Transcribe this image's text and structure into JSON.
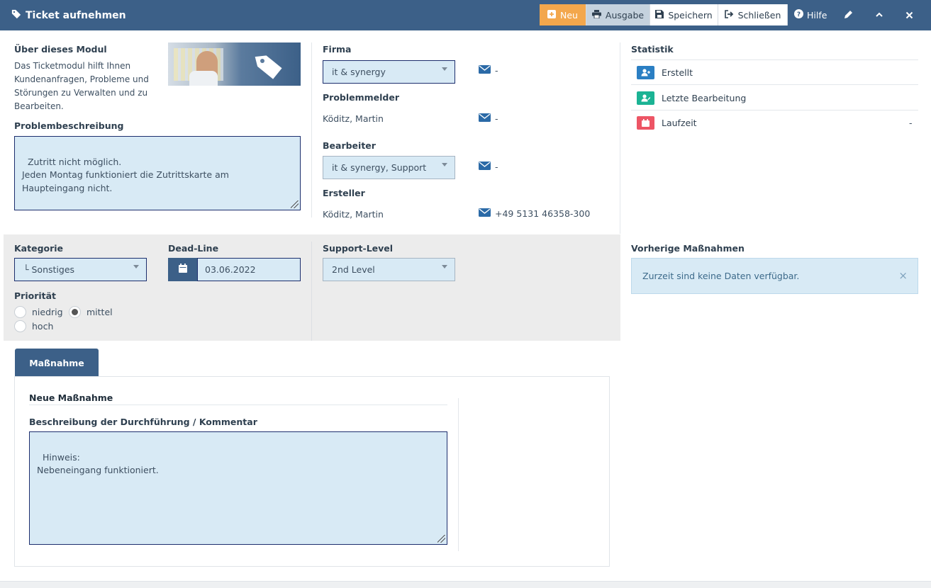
{
  "header": {
    "title": "Ticket aufnehmen",
    "buttons": {
      "neu": "Neu",
      "ausgabe": "Ausgabe",
      "speichern": "Speichern",
      "schliessen": "Schließen",
      "hilfe": "Hilfe"
    }
  },
  "about": {
    "title": "Über dieses Modul",
    "text": "Das Ticketmodul hilft Ihnen Kundenanfragen, Probleme und Störungen zu Verwalten und zu Bearbeiten."
  },
  "problem": {
    "label": "Problembeschreibung",
    "value": "Zutritt nicht möglich.\nJeden Montag funktioniert die Zutrittskarte am Haupteingang nicht."
  },
  "firma": {
    "label": "Firma",
    "value": "it & synergy",
    "mail": "-"
  },
  "problemmelder": {
    "label": "Problemmelder",
    "value": "Köditz, Martin",
    "mail": "-"
  },
  "bearbeiter": {
    "label": "Bearbeiter",
    "value": "it & synergy, Support",
    "mail": "-"
  },
  "ersteller": {
    "label": "Ersteller",
    "value": "Köditz, Martin",
    "phone": "+49 5131 46358-300"
  },
  "statistik": {
    "title": "Statistik",
    "items": [
      {
        "label": "Erstellt",
        "value": "",
        "color": "#2b7fc3"
      },
      {
        "label": "Letzte Bearbeitung",
        "value": "",
        "color": "#1bb394"
      },
      {
        "label": "Laufzeit",
        "value": "-",
        "color": "#ed5565"
      }
    ]
  },
  "kategorie": {
    "label": "Kategorie",
    "value": "└ Sonstiges"
  },
  "deadline": {
    "label": "Dead-Line",
    "value": "03.06.2022"
  },
  "supportlevel": {
    "label": "Support-Level",
    "value": "2nd Level"
  },
  "prioritaet": {
    "label": "Priorität",
    "options": [
      "niedrig",
      "mittel",
      "hoch"
    ],
    "selected": "mittel"
  },
  "vorherige": {
    "title": "Vorherige Maßnahmen",
    "empty_text": "Zurzeit sind keine Daten verfügbar.",
    "close": "×"
  },
  "massnahme": {
    "tab": "Maßnahme",
    "section_title": "Neue Maßnahme",
    "desc_label": "Beschreibung der Durchführung / Kommentar",
    "desc_value": "Hinweis:\nNebeneingang funktioniert."
  },
  "colors": {
    "header_bg": "#3c6088",
    "accent_orange": "#f3a74c",
    "input_bg": "#d8eaf5"
  }
}
